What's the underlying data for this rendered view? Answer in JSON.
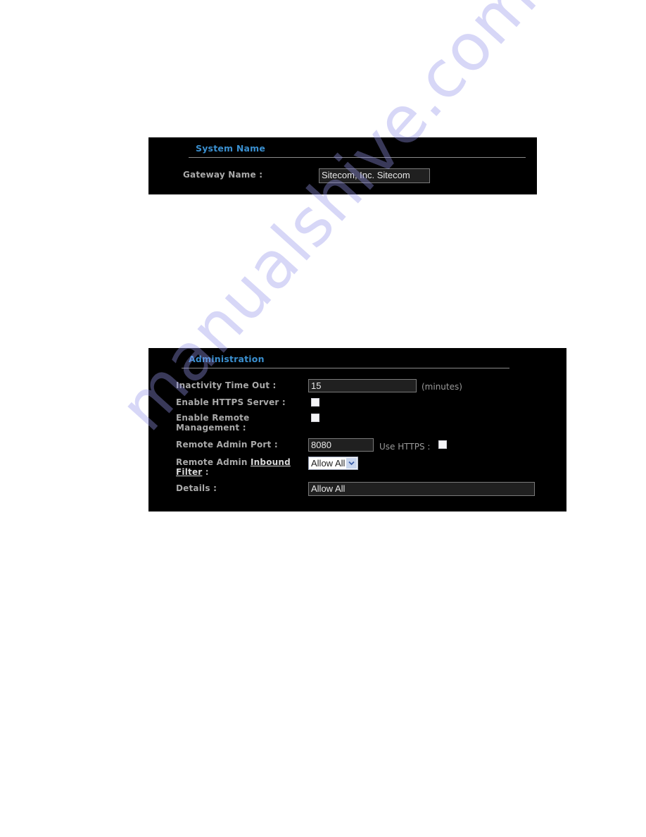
{
  "system_name_section": {
    "title": "System Name",
    "gateway_name_label": "Gateway Name :",
    "gateway_name_value": "Sitecom, Inc. Sitecom"
  },
  "administration_section": {
    "title": "Administration",
    "inactivity_timeout": {
      "label": "Inactivity Time Out :",
      "value": "15",
      "unit": "(minutes)"
    },
    "enable_https_server": {
      "label": "Enable HTTPS Server :",
      "checked": false
    },
    "enable_remote_management": {
      "label_line1": "Enable Remote",
      "label_line2": "Management :",
      "checked": false
    },
    "remote_admin_port": {
      "label": "Remote Admin Port :",
      "value": "8080",
      "use_https_label": "Use HTTPS :",
      "use_https_checked": false
    },
    "inbound_filter": {
      "label_prefix": "Remote Admin ",
      "link_part1": "Inbound",
      "link_part2": "Filter",
      "label_suffix": " :",
      "selected": "Allow All"
    },
    "details": {
      "label": "Details :",
      "value": "Allow All"
    }
  },
  "icons": {
    "select_arrow": "chevron-down-icon"
  },
  "colors": {
    "panel_background": "#000000",
    "section_title": "#3a8fcf",
    "label_text": "#a9a9a9",
    "watermark": "#9696eb"
  },
  "watermark": {
    "text": "manualshive.com"
  }
}
